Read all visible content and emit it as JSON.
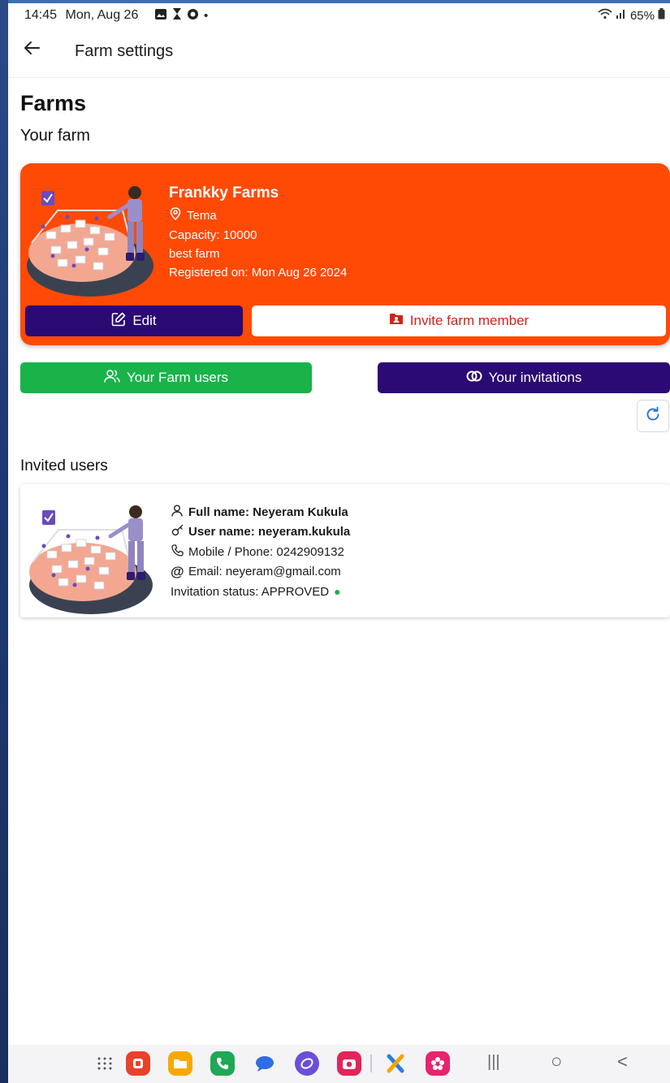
{
  "status": {
    "time": "14:45",
    "date": "Mon, Aug 26",
    "battery": "65%",
    "dot": "•"
  },
  "appbar": {
    "title": "Farm settings"
  },
  "page": {
    "heading": "Farms",
    "subheading": "Your farm"
  },
  "farm": {
    "name": "Frankky Farms",
    "location": "Tema",
    "capacity": "Capacity: 10000",
    "description": "best farm",
    "registered": "Registered on: Mon Aug 26 2024",
    "edit_label": "Edit",
    "invite_label": "Invite farm member",
    "card_color": "#ff4a06"
  },
  "actions": {
    "users_label": "Your Farm users",
    "invitations_label": "Your invitations",
    "users_color": "#19b34a",
    "invitations_color": "#2b0a73"
  },
  "invited": {
    "heading": "Invited users",
    "users": [
      {
        "full_name": "Full name: Neyeram Kukula",
        "user_name": "User name: neyeram.kukula",
        "phone": "Mobile / Phone: 0242909132",
        "email": "Email: neyeram@gmail.com",
        "status": "Invitation status: APPROVED",
        "status_dot": "●"
      }
    ]
  },
  "navbar": {
    "icons": [
      "apps-grid-icon",
      "app-red-icon",
      "app-folder-icon",
      "app-phone-icon",
      "app-messages-icon",
      "app-internet-icon",
      "app-camera-icon",
      "app-x-icon",
      "app-flower-icon"
    ],
    "recents_symbol": "|||",
    "home_symbol": "○",
    "back_symbol": "<"
  }
}
